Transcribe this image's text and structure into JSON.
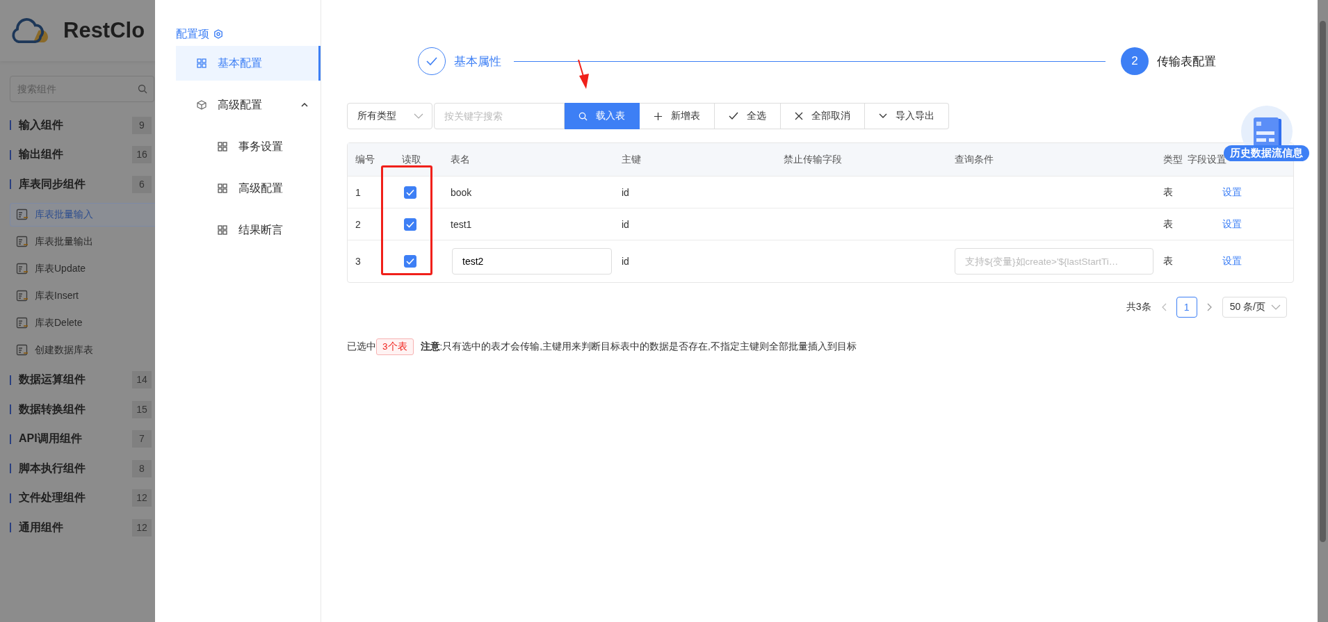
{
  "sidebar": {
    "logo_text": "RestClo",
    "search": {
      "placeholder": "搜索组件"
    },
    "items": [
      {
        "kind": "group",
        "label": "输入组件",
        "count": "9"
      },
      {
        "kind": "group",
        "label": "输出组件",
        "count": "16"
      },
      {
        "kind": "group",
        "label": "库表同步组件",
        "count": "6"
      },
      {
        "kind": "component",
        "label": "库表批量输入",
        "selected": true
      },
      {
        "kind": "component",
        "label": "库表批量输出",
        "selected": false
      },
      {
        "kind": "component",
        "label": "库表Update",
        "selected": false
      },
      {
        "kind": "component",
        "label": "库表Insert",
        "selected": false
      },
      {
        "kind": "component",
        "label": "库表Delete",
        "selected": false
      },
      {
        "kind": "component",
        "label": "创建数据库表",
        "selected": false
      },
      {
        "kind": "group",
        "label": "数据运算组件",
        "count": "14"
      },
      {
        "kind": "group",
        "label": "数据转换组件",
        "count": "15"
      },
      {
        "kind": "group",
        "label": "API调用组件",
        "count": "7"
      },
      {
        "kind": "group",
        "label": "脚本执行组件",
        "count": "8"
      },
      {
        "kind": "group",
        "label": "文件处理组件",
        "count": "12"
      },
      {
        "kind": "group",
        "label": "通用组件",
        "count": "12"
      }
    ]
  },
  "config_menu": {
    "title": "配置项",
    "items": [
      {
        "label": "基本配置",
        "selected": true
      },
      {
        "label": "高级配置",
        "selected": false,
        "expanded": true,
        "children": [
          {
            "label": "事务设置",
            "selected": false
          },
          {
            "label": "高级配置",
            "selected": false
          },
          {
            "label": "结果断言",
            "selected": false
          }
        ]
      }
    ]
  },
  "steps": [
    {
      "label": "基本属性",
      "completed": true
    },
    {
      "number": "2",
      "label": "传输表配置",
      "completed": false
    }
  ],
  "toolbar": {
    "type_select": "所有类型",
    "search": {
      "placeholder": "按关键字搜索"
    },
    "buttons": [
      {
        "label": "载入表",
        "primary": true
      },
      {
        "label": "新增表",
        "primary": false
      },
      {
        "label": "全选",
        "primary": false
      },
      {
        "label": "全部取消",
        "primary": false
      },
      {
        "label": "导入导出",
        "primary": false
      }
    ]
  },
  "table": {
    "columns": [
      "编号",
      "读取",
      "表名",
      "主键",
      "禁止传输字段",
      "查询条件",
      "类型",
      "字段设置"
    ],
    "rows": [
      {
        "no": "1",
        "checked": true,
        "name": "book",
        "editing": false,
        "key": "id",
        "type": "表",
        "action": "设置"
      },
      {
        "no": "2",
        "checked": true,
        "name": "test1",
        "editing": false,
        "key": "id",
        "type": "表",
        "action": "设置"
      },
      {
        "no": "3",
        "checked": true,
        "name": "test2",
        "editing": true,
        "key": "id",
        "query_placeholder": "支持${变量}如create>'${lastStartTi…",
        "type": "表",
        "action": "设置"
      }
    ]
  },
  "pagination": {
    "total": "共3条",
    "pages": [
      {
        "label": "1",
        "selected": true
      }
    ],
    "page_size": "50 条/页"
  },
  "footer": {
    "prefix": "已选中",
    "tag": "3个表",
    "note": "**注意**:只有选中的表才会传输,主键用来判断目标表中的数据是否存在,不指定主键则全部批量插入到目标"
  },
  "floating_badge": {
    "label": "历史数据流信息"
  }
}
